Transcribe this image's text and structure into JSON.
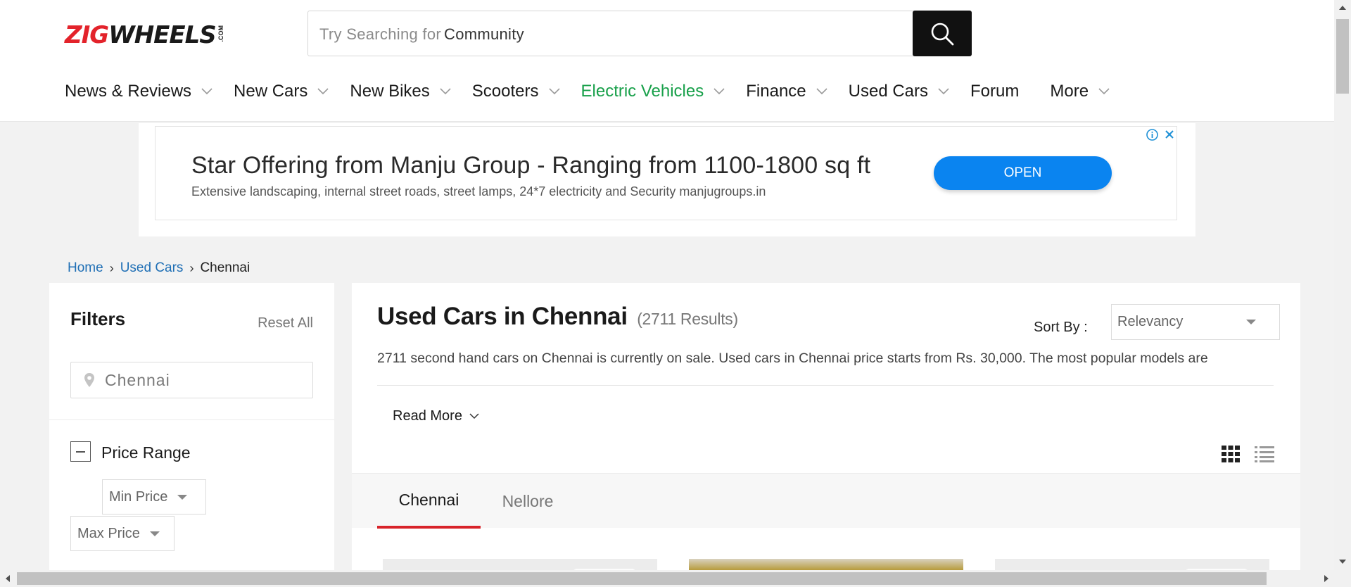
{
  "brand": {
    "logo_text_red": "ZIG",
    "logo_text_dark": "WHEELS",
    "logo_suffix": ".COM"
  },
  "search": {
    "placeholder_prefix": "Try Searching for",
    "rotating_term": "Community",
    "button_icon": "search-icon"
  },
  "nav": {
    "items": [
      {
        "label": "News & Reviews",
        "dropdown": true
      },
      {
        "label": "New Cars",
        "dropdown": true
      },
      {
        "label": "New Bikes",
        "dropdown": true
      },
      {
        "label": "Scooters",
        "dropdown": true
      },
      {
        "label": "Electric Vehicles",
        "dropdown": true,
        "color": "#18a04a"
      },
      {
        "label": "Finance",
        "dropdown": true
      },
      {
        "label": "Used Cars",
        "dropdown": true
      },
      {
        "label": "Forum",
        "dropdown": false
      },
      {
        "label": "More",
        "dropdown": true
      }
    ]
  },
  "ad": {
    "title": "Star Offering from Manju Group - Ranging from 1100-1800 sq ft",
    "subtitle": "Extensive landscaping, internal street roads, street lamps, 24*7 electricity and Security manjugroups.in",
    "cta": "OPEN",
    "cta_color": "#0a84f0",
    "icons": [
      "info-icon",
      "close-icon"
    ]
  },
  "breadcrumb": {
    "home": "Home",
    "section": "Used Cars",
    "current": "Chennai",
    "separator": "›"
  },
  "filters": {
    "title": "Filters",
    "reset": "Reset All",
    "city_value": "Chennai",
    "price_range_label": "Price Range",
    "min_price": "Min Price",
    "max_price": "Max Price"
  },
  "main": {
    "title": "Used Cars in Chennai",
    "result_count": "(2711 Results)",
    "sort_label": "Sort By :",
    "sort_value": "Relevancy",
    "description": "2711 second hand cars on Chennai is currently on sale. Used cars in Chennai price starts from Rs. 30,000. The most popular models are",
    "read_more": "Read More",
    "tabs": [
      {
        "label": "Chennai",
        "active": true
      },
      {
        "label": "Nellore",
        "active": false
      }
    ],
    "accent_color": "#d8232a"
  }
}
